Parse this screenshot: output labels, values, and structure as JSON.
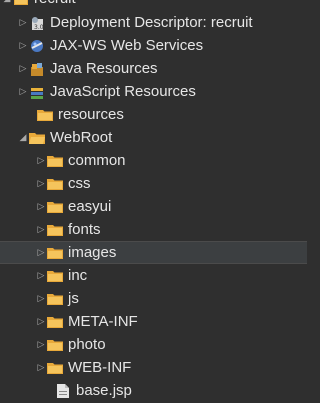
{
  "project_explorer": {
    "root": {
      "label": "recruit",
      "icon": "project-icon",
      "expanded": true
    },
    "items": [
      {
        "label": "Deployment Descriptor: recruit",
        "icon": "deployment-descriptor-icon",
        "expanded": false
      },
      {
        "label": "JAX-WS Web Services",
        "icon": "web-services-icon",
        "expanded": false
      },
      {
        "label": "Java Resources",
        "icon": "java-resources-icon",
        "expanded": false
      },
      {
        "label": "JavaScript Resources",
        "icon": "javascript-resources-icon",
        "expanded": false
      },
      {
        "label": "resources",
        "icon": "folder-icon"
      },
      {
        "label": "WebRoot",
        "icon": "folder-icon",
        "expanded": true,
        "children": [
          {
            "label": "common",
            "icon": "folder-icon",
            "expanded": false
          },
          {
            "label": "css",
            "icon": "folder-icon",
            "expanded": false
          },
          {
            "label": "easyui",
            "icon": "folder-icon",
            "expanded": false
          },
          {
            "label": "fonts",
            "icon": "folder-icon",
            "expanded": false
          },
          {
            "label": "images",
            "icon": "folder-icon",
            "expanded": false,
            "selected": true
          },
          {
            "label": "inc",
            "icon": "folder-icon",
            "expanded": false
          },
          {
            "label": "js",
            "icon": "folder-icon",
            "expanded": false
          },
          {
            "label": "META-INF",
            "icon": "folder-icon",
            "expanded": false
          },
          {
            "label": "photo",
            "icon": "folder-icon",
            "expanded": false
          },
          {
            "label": "WEB-INF",
            "icon": "folder-icon",
            "expanded": false
          },
          {
            "label": "base.jsp",
            "icon": "jsp-file-icon"
          }
        ]
      }
    ]
  },
  "colors": {
    "background": "#2f2f2f",
    "selection": "#3c3f41",
    "text": "#e6e6e6",
    "folder": "#e8a93a"
  }
}
